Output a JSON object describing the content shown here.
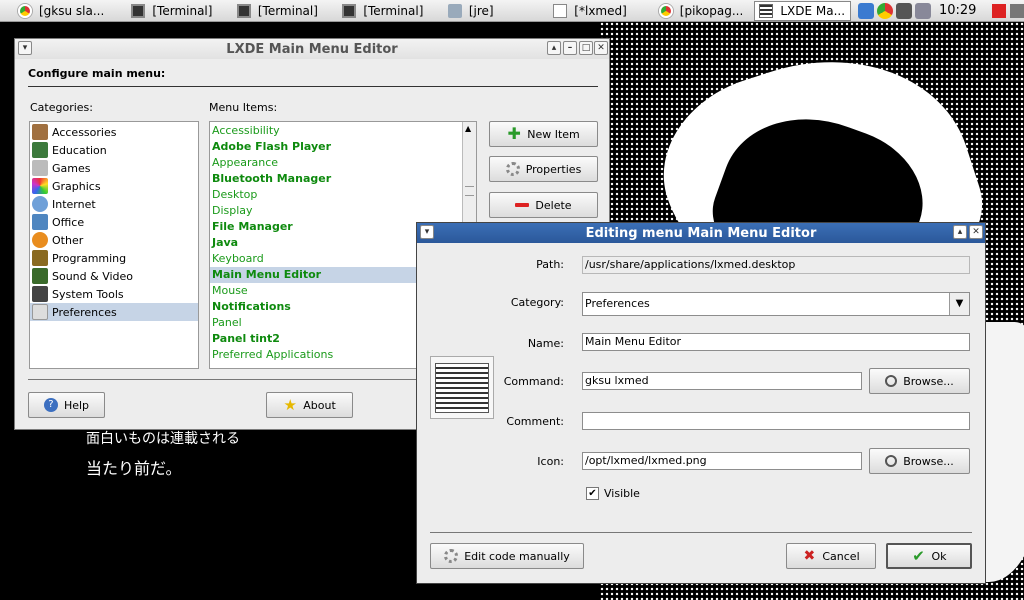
{
  "taskbar": {
    "tasks": [
      "[gksu sla...",
      "[Terminal]",
      "[Terminal]",
      "[Terminal]",
      "[jre]",
      "[*lxmed]",
      "[pikopag...",
      "LXDE Ma..."
    ],
    "clock": "10:29"
  },
  "desktop": {
    "jp_line1": "面白いものは連載される",
    "jp_line2": "当たり前だ。"
  },
  "main": {
    "title": "LXDE Main Menu Editor",
    "heading": "Configure main menu:",
    "categories_label": "Categories:",
    "menu_items_label": "Menu Items:",
    "categories": [
      "Accessories",
      "Education",
      "Games",
      "Graphics",
      "Internet",
      "Office",
      "Other",
      "Programming",
      "Sound & Video",
      "System Tools",
      "Preferences"
    ],
    "menu_items": [
      "Accessibility",
      "Adobe Flash Player",
      "Appearance",
      "Bluetooth Manager",
      "Desktop",
      "Display",
      "File Manager",
      "Java",
      "Keyboard",
      "Main Menu Editor",
      "Mouse",
      "Notifications",
      "Panel",
      "Panel tint2",
      "Preferred Applications"
    ],
    "new_item": "New Item",
    "properties": "Properties",
    "delete": "Delete",
    "help": "Help",
    "about": "About"
  },
  "dialog": {
    "title": "Editing menu Main Menu Editor",
    "path_label": "Path:",
    "path_value": "/usr/share/applications/lxmed.desktop",
    "category_label": "Category:",
    "category_value": "Preferences",
    "name_label": "Name:",
    "name_value": "Main Menu Editor",
    "command_label": "Command:",
    "command_value": "gksu lxmed",
    "comment_label": "Comment:",
    "comment_value": "",
    "icon_label": "Icon:",
    "icon_value": "/opt/lxmed/lxmed.png",
    "browse": "Browse...",
    "visible": "Visible",
    "edit_code": "Edit code manually",
    "cancel": "Cancel",
    "ok": "Ok"
  },
  "colors": {
    "selection": "#c6d4e6",
    "menu_item_green": "#1a9a1a",
    "dialog_title": "#2f5fa6"
  }
}
